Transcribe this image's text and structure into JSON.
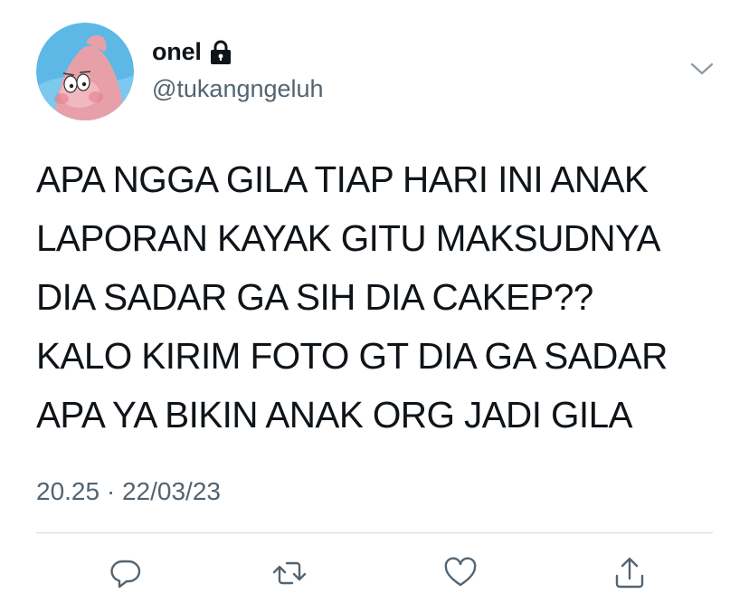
{
  "user": {
    "display_name": "onel",
    "handle": "@tukangngeluh",
    "protected": true
  },
  "tweet": {
    "lines": [
      "APA NGGA GILA TIAP HARI INI ANAK",
      "LAPORAN KAYAK GITU MAKSUDNYA",
      "DIA SADAR GA SIH DIA CAKEP??",
      "KALO KIRIM FOTO GT DIA GA SADAR",
      "APA YA BIKIN ANAK ORG JADI GILA"
    ],
    "time": "20.25",
    "separator": "·",
    "date": "22/03/23"
  },
  "actions": [
    {
      "name": "reply",
      "icon": "reply-icon"
    },
    {
      "name": "retweet",
      "icon": "retweet-icon"
    },
    {
      "name": "like",
      "icon": "heart-icon"
    },
    {
      "name": "share",
      "icon": "share-icon"
    }
  ],
  "colors": {
    "text": "#0f1419",
    "secondary": "#536471",
    "divider": "#cfd9de",
    "icon": "#536471"
  }
}
